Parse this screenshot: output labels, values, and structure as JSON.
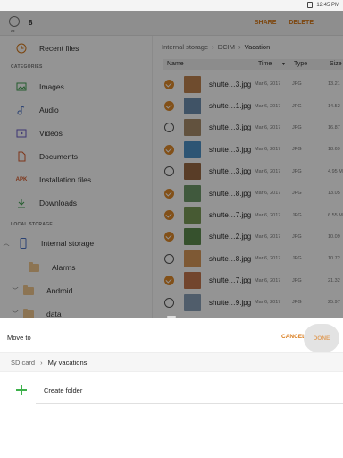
{
  "status_bar": {
    "time": "12:45 PM"
  },
  "top_bar": {
    "select_all_label": "All",
    "selected_count": "8",
    "share": "SHARE",
    "delete": "DELETE"
  },
  "sidebar": {
    "recent": "Recent files",
    "categories_header": "CATEGORIES",
    "categories": [
      "Images",
      "Audio",
      "Videos",
      "Documents",
      "Installation files",
      "Downloads"
    ],
    "apk_badge": "APK",
    "storage_header": "LOCAL STORAGE",
    "internal_storage": "Internal storage",
    "folders": [
      "Alarms",
      "Android",
      "data"
    ]
  },
  "main": {
    "breadcrumb": [
      "Internal storage",
      "DCIM",
      "Vacation"
    ],
    "columns": {
      "name": "Name",
      "time": "Time",
      "type": "Type",
      "size": "Size"
    },
    "files": [
      {
        "name": "shutte…3.jpg",
        "date": "Mar 6, 2017",
        "type": "JPG",
        "size": "13.21",
        "checked": true,
        "thumb": "#c08450"
      },
      {
        "name": "shutte…1.jpg",
        "date": "Mar 6, 2017",
        "type": "JPG",
        "size": "14.52",
        "checked": true,
        "thumb": "#6f8fb0"
      },
      {
        "name": "shutte…3.jpg",
        "date": "Mar 6, 2017",
        "type": "JPG",
        "size": "16.87",
        "checked": false,
        "thumb": "#a98e6c"
      },
      {
        "name": "shutte…3.jpg",
        "date": "Mar 6, 2017",
        "type": "JPG",
        "size": "18.69",
        "checked": true,
        "thumb": "#4f93c9"
      },
      {
        "name": "shutte…3.jpg",
        "date": "Mar 6, 2017",
        "type": "JPG",
        "size": "4.95 M",
        "checked": false,
        "thumb": "#9a6a44"
      },
      {
        "name": "shutte…8.jpg",
        "date": "Mar 6, 2017",
        "type": "JPG",
        "size": "13.05",
        "checked": true,
        "thumb": "#6f9a6a"
      },
      {
        "name": "shutte…7.jpg",
        "date": "Mar 6, 2017",
        "type": "JPG",
        "size": "6.55 M",
        "checked": true,
        "thumb": "#7a9c58"
      },
      {
        "name": "shutte…2.jpg",
        "date": "Mar 6, 2017",
        "type": "JPG",
        "size": "10.09",
        "checked": true,
        "thumb": "#5e8c4f"
      },
      {
        "name": "shutte…8.jpg",
        "date": "Mar 6, 2017",
        "type": "JPG",
        "size": "10.72",
        "checked": false,
        "thumb": "#d99a5a"
      },
      {
        "name": "shutte…7.jpg",
        "date": "Mar 6, 2017",
        "type": "JPG",
        "size": "21.32",
        "checked": true,
        "thumb": "#c4784e"
      },
      {
        "name": "shutte…9.jpg",
        "date": "Mar 6, 2017",
        "type": "JPG",
        "size": "25.97",
        "checked": false,
        "thumb": "#8aa0b8"
      }
    ]
  },
  "sheet": {
    "title": "Move to",
    "cancel": "CANCEL",
    "done": "DONE",
    "path": [
      "SD card",
      "My vacations"
    ],
    "create_folder": "Create folder"
  }
}
